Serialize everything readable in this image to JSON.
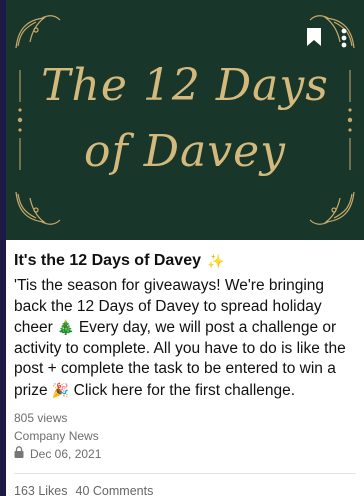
{
  "banner": {
    "line1": "The 12 Days",
    "line2": "of Davey",
    "icons": {
      "bookmark": "bookmark-icon",
      "more": "more-vertical-icon"
    },
    "colors": {
      "background": "#18362a",
      "gold": "#d4b97c"
    }
  },
  "post": {
    "title": "It's the 12 Days of Davey",
    "body_part1": "'Tis the season for giveaways! We're bringing back the 12 Days of Davey to spread holiday cheer",
    "body_part2": "Every day, we will post a challenge or activity to complete. All you have to do is like the post + complete the task to be entered to win a prize",
    "body_part3": "Click here for the first challenge.",
    "views": "805 views",
    "category": "Company News",
    "date": "Dec 06, 2021"
  },
  "stats": {
    "likes": "163 Likes",
    "comments": "40 Comments"
  }
}
